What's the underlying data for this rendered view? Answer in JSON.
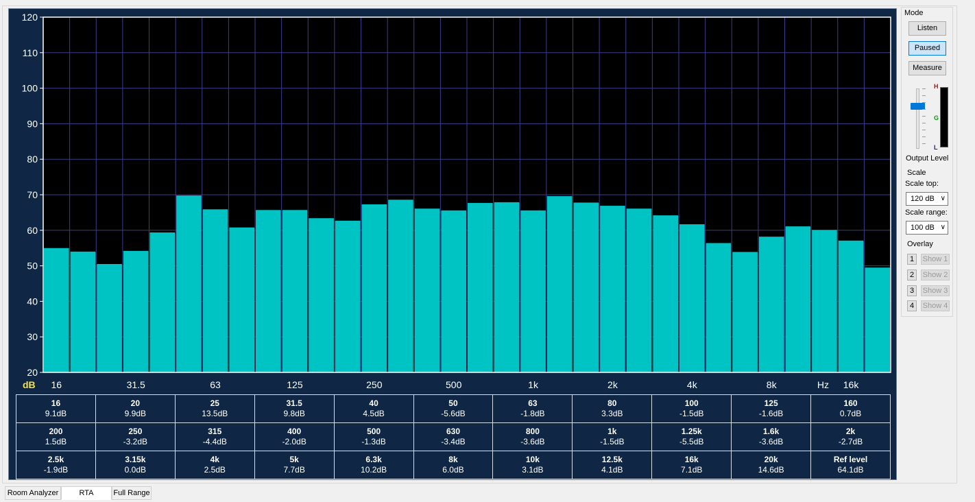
{
  "chart_data": {
    "type": "bar",
    "ylim": [
      20,
      120
    ],
    "y_ticks": [
      "20",
      "30",
      "40",
      "50",
      "60",
      "70",
      "80",
      "90",
      "100",
      "110",
      "120"
    ],
    "x_ticks": [
      "16",
      "31.5",
      "63",
      "125",
      "250",
      "500",
      "1k",
      "2k",
      "4k",
      "8k",
      "Hz",
      "16k"
    ],
    "ylabel": "dB",
    "grid": true,
    "bar_color": "#00c4c4",
    "background": "#000000",
    "grid_color": "#3c3c8c",
    "values": [
      55,
      54,
      50.5,
      54.2,
      59.4,
      69.8,
      65.9,
      60.8,
      65.7,
      65.7,
      63.4,
      62.7,
      67.3,
      68.6,
      66.1,
      65.6,
      67.7,
      67.9,
      65.6,
      69.6,
      67.8,
      66.9,
      66.1,
      64.2,
      61.7,
      56.4,
      53.9,
      58.2,
      61.1,
      60.1,
      57.1,
      49.5
    ]
  },
  "table": {
    "rows": [
      [
        {
          "f": "16",
          "v": "9.1dB"
        },
        {
          "f": "20",
          "v": "9.9dB"
        },
        {
          "f": "25",
          "v": "13.5dB"
        },
        {
          "f": "31.5",
          "v": "9.8dB"
        },
        {
          "f": "40",
          "v": "4.5dB"
        },
        {
          "f": "50",
          "v": "-5.6dB"
        },
        {
          "f": "63",
          "v": "-1.8dB"
        },
        {
          "f": "80",
          "v": "3.3dB"
        },
        {
          "f": "100",
          "v": "-1.5dB"
        },
        {
          "f": "125",
          "v": "-1.6dB"
        },
        {
          "f": "160",
          "v": "0.7dB"
        }
      ],
      [
        {
          "f": "200",
          "v": "1.5dB"
        },
        {
          "f": "250",
          "v": "-3.2dB"
        },
        {
          "f": "315",
          "v": "-4.4dB"
        },
        {
          "f": "400",
          "v": "-2.0dB"
        },
        {
          "f": "500",
          "v": "-1.3dB"
        },
        {
          "f": "630",
          "v": "-3.4dB"
        },
        {
          "f": "800",
          "v": "-3.6dB"
        },
        {
          "f": "1k",
          "v": "-1.5dB"
        },
        {
          "f": "1.25k",
          "v": "-5.5dB"
        },
        {
          "f": "1.6k",
          "v": "-3.6dB"
        },
        {
          "f": "2k",
          "v": "-2.7dB"
        }
      ],
      [
        {
          "f": "2.5k",
          "v": "-1.9dB"
        },
        {
          "f": "3.15k",
          "v": "0.0dB"
        },
        {
          "f": "4k",
          "v": "2.5dB"
        },
        {
          "f": "5k",
          "v": "7.7dB"
        },
        {
          "f": "6.3k",
          "v": "10.2dB"
        },
        {
          "f": "8k",
          "v": "6.0dB"
        },
        {
          "f": "10k",
          "v": "3.1dB"
        },
        {
          "f": "12.5k",
          "v": "4.1dB"
        },
        {
          "f": "16k",
          "v": "7.1dB"
        },
        {
          "f": "20k",
          "v": "14.6dB"
        },
        {
          "f": "Ref level",
          "v": "64.1dB"
        }
      ]
    ]
  },
  "mode": {
    "title": "Mode",
    "listen": "Listen",
    "paused": "Paused",
    "measure": "Measure",
    "active": "Paused"
  },
  "output": {
    "label": "Output Level",
    "meter_h": "H",
    "meter_g": "G",
    "meter_l": "L",
    "slider_level": 0.7
  },
  "scale": {
    "title": "Scale",
    "top_label": "Scale top:",
    "top_value": "120 dB",
    "range_label": "Scale range:",
    "range_value": "100 dB"
  },
  "overlay": {
    "title": "Overlay",
    "items": [
      {
        "num": "1",
        "show": "Show 1"
      },
      {
        "num": "2",
        "show": "Show 2"
      },
      {
        "num": "3",
        "show": "Show 3"
      },
      {
        "num": "4",
        "show": "Show 4"
      }
    ]
  },
  "tabs": [
    "Room Analyzer",
    "RTA",
    "Full Range"
  ],
  "selected_tab": "RTA",
  "colors": {
    "panel_bg": "#0f2745",
    "tick_text": "#ffffff",
    "db_label": "#f5e14a"
  }
}
